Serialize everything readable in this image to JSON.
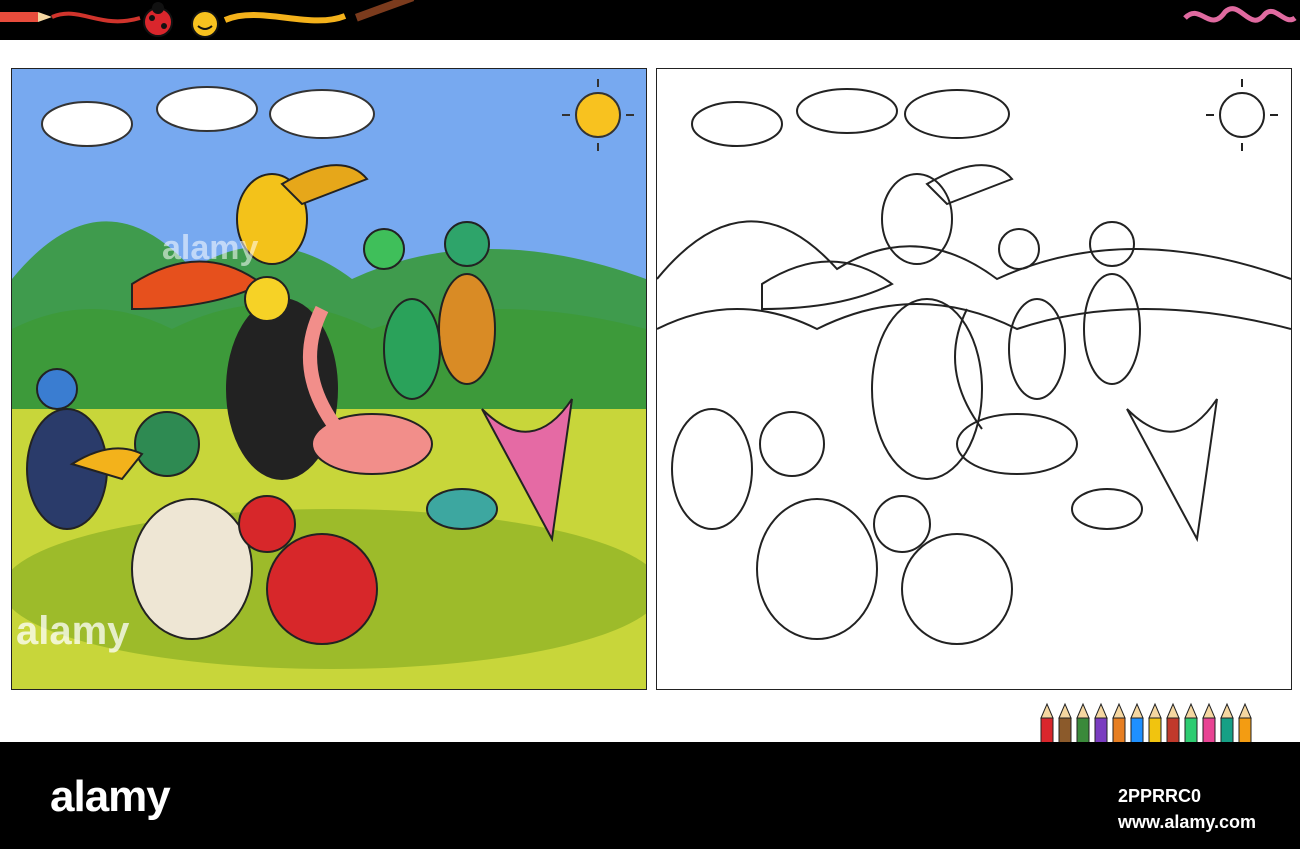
{
  "watermark": {
    "brand": "alamy",
    "panel_text": "alamy",
    "image_code": "2PPRRC0",
    "site": "www.alamy.com"
  },
  "scene": {
    "left_panel": "color",
    "right_panel": "line-art",
    "icons": [
      "ladybug-icon",
      "sun-icon",
      "paintbrush-icon",
      "pencil-icon",
      "cloud-icon"
    ]
  },
  "colors": {
    "sky": "#77a9f0",
    "grass": "#c8d63a",
    "hill": "#3f9b4d",
    "sun": "#f8c21f",
    "bar": "#000000"
  }
}
